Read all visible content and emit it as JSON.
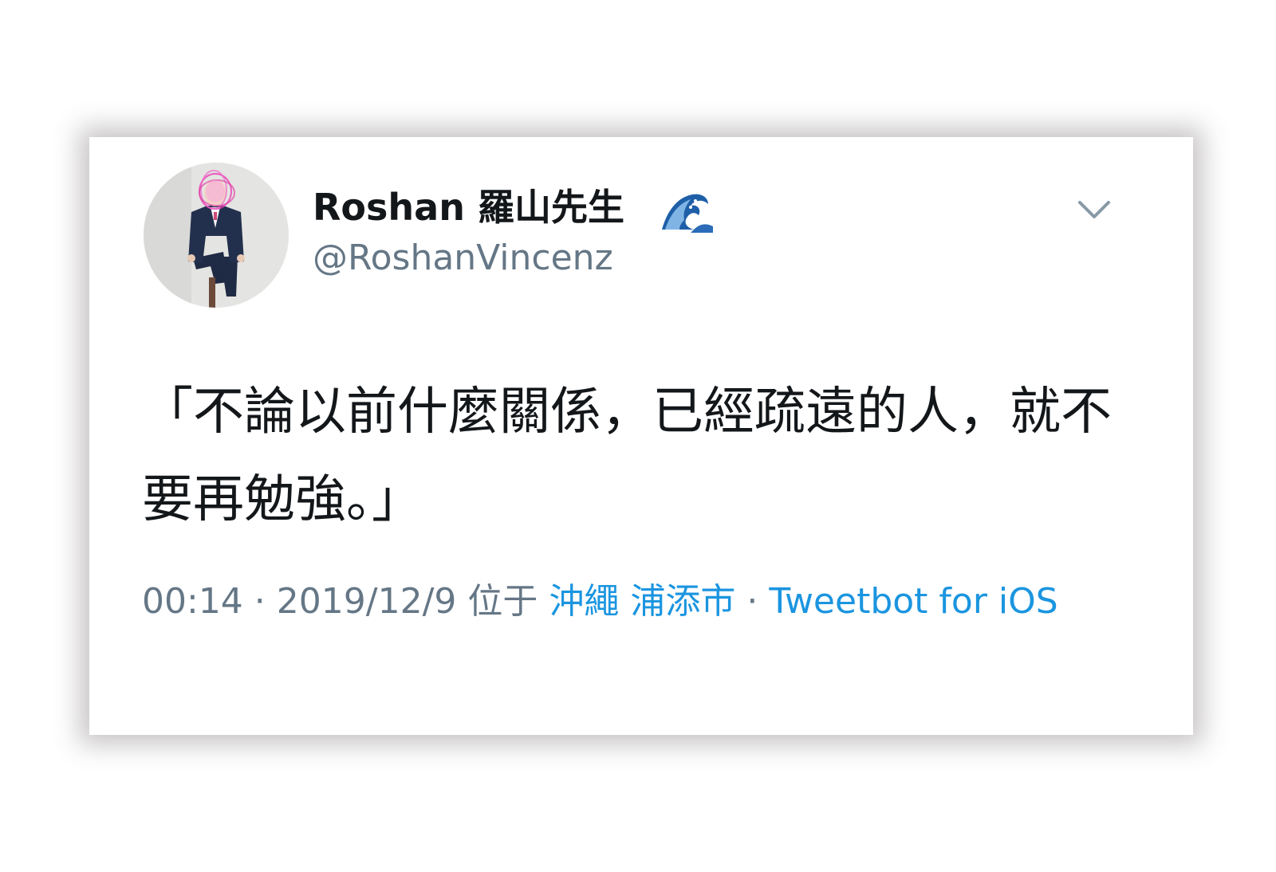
{
  "tweet": {
    "display_name": "Roshan 羅山先生",
    "handle": "@RoshanVincenz",
    "name_emoji_icon": "water-wave-emoji-icon",
    "text": "「不論以前什麼關係，已經疏遠的人，就不要再勉強。」",
    "meta": {
      "time": "00:14",
      "separator": " · ",
      "date": "2019/12/9",
      "location_prefix": " 位于 ",
      "location": "沖繩 浦添市",
      "source": "Tweetbot for iOS"
    }
  },
  "colors": {
    "text": "#14171a",
    "secondary": "#657786",
    "link": "#1b95e0"
  }
}
